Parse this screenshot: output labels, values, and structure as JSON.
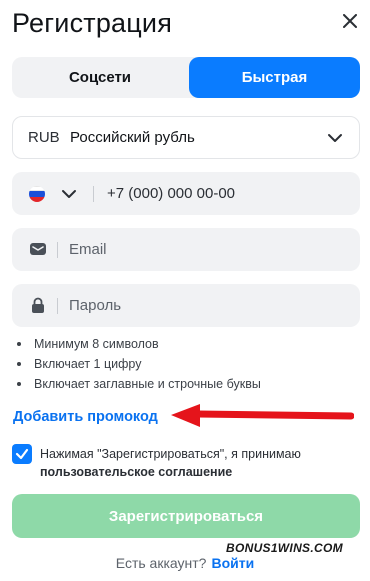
{
  "header": {
    "title": "Регистрация",
    "close_icon": "close-icon"
  },
  "tabs": [
    {
      "label": "Соцсети",
      "active": false
    },
    {
      "label": "Быстрая",
      "active": true
    }
  ],
  "currency": {
    "code": "RUB",
    "name": "Российский рубль",
    "chevron_icon": "chevron-down-icon"
  },
  "phone": {
    "flag_icon": "russia-flag-icon",
    "placeholder": "+7 (000) 000 00-00"
  },
  "email": {
    "icon": "envelope-icon",
    "placeholder": "Email"
  },
  "password": {
    "icon": "lock-icon",
    "placeholder": "Пароль"
  },
  "password_rules": [
    "Минимум 8 символов",
    "Включает 1 цифру",
    "Включает заглавные и строчные буквы"
  ],
  "promo_link": "Добавить промокод",
  "agreement": {
    "checked": true,
    "text": "Нажимая \"Зарегистрироваться\", я принимаю",
    "link": "пользовательское соглашение"
  },
  "submit_label": "Зарегистрироваться",
  "watermark": "BONUS1WINS.COM",
  "login": {
    "question": "Есть аккаунт?",
    "link": "Войти"
  },
  "colors": {
    "accent": "#0a7cff",
    "link": "#0a72f0",
    "submit_disabled": "#8ed9a8",
    "arrow": "#e5141b",
    "field_bg": "#f1f2f4"
  }
}
